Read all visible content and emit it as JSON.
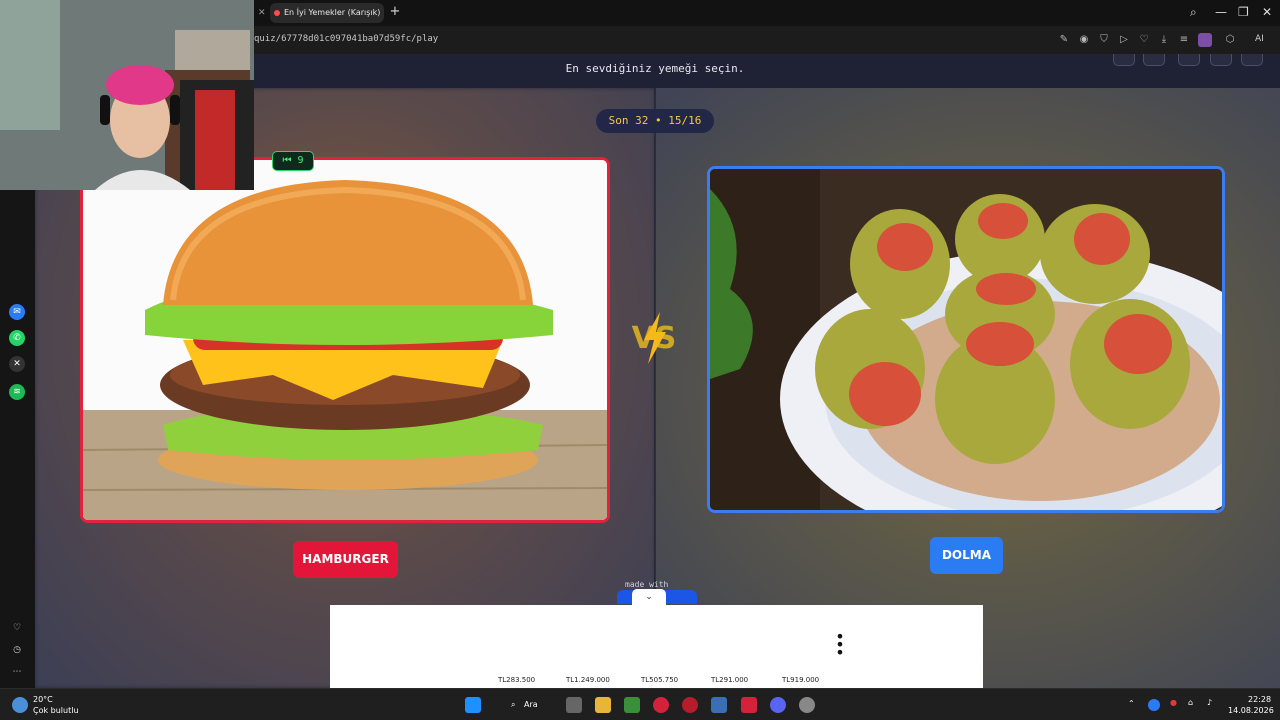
{
  "browser": {
    "tab_title": "En İyi Yemekler (Karışık)",
    "tab_close": "✕",
    "new_tab": "+",
    "url": "quiz/67778d01c097041ba07d59fc/play",
    "ai_label": "AI",
    "window_controls": [
      "—",
      "❐",
      "✕"
    ]
  },
  "quiz": {
    "subtitle": "En sevdiğiniz yemeği seçin.",
    "round_label": "Son 32 • 15/16",
    "hint_badge": "9",
    "left_choice": "HAMBURGER",
    "right_choice": "DOLMA",
    "made_with": "made with"
  },
  "ad": {
    "chevron": "⌄",
    "prices": [
      "TL283.500",
      "TL1.249.000",
      "TL505.750",
      "TL291.000",
      "TL919.000"
    ]
  },
  "taskbar": {
    "temperature": "20°C",
    "weather": "Çok bulutlu",
    "search_label": "Ara",
    "time": "22:28",
    "date": "14.08.2026"
  },
  "colors": {
    "left_accent": "#e3163a",
    "right_accent": "#2b7cf2",
    "round_text": "#f5c842"
  }
}
